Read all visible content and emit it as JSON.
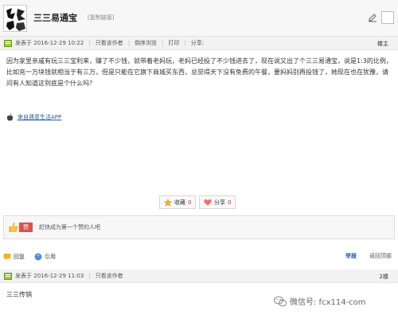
{
  "header": {
    "title": "三三易通宝",
    "copy_link": "[复制链接]"
  },
  "post": {
    "posted_prefix": "发表于",
    "timestamp": "2016-12-29 10:22",
    "only_author": "只看该作者",
    "reverse_browse": "倒序浏览",
    "print": "打印",
    "share": "分享:",
    "floor": "楼主",
    "body": "因为家里亲戚有玩三三宝利来，赚了不少钱，就带着老妈玩，老妈已经投了不少钱进去了，现在说又出了个三三易通宝，说是1:3的比例，比如充一万块钱就相当于有三万，但是只能在它旗下商城买东西，总觉得天下没有免费的午餐，要妈妈别再投钱了，她现在也在犹豫，请问有人知道这到底是个什么吗？",
    "app_link": "来自遇意生活APP",
    "favorite_label": "收藏",
    "favorite_count": "0",
    "share_label": "分享",
    "share_count": "0",
    "like_button": "赞",
    "like_text": "赶快成为第一个赞的人吧",
    "reply_label": "回复",
    "quote_label": "引用",
    "report_label": "举报",
    "top_label": "返回顶部"
  },
  "reply": {
    "posted_prefix": "发表于",
    "timestamp": "2016-12-29 11:03",
    "only_author": "只看该作者",
    "floor": "2楼",
    "body": "三三传销"
  },
  "watermark": "微信号: fcx114-com"
}
